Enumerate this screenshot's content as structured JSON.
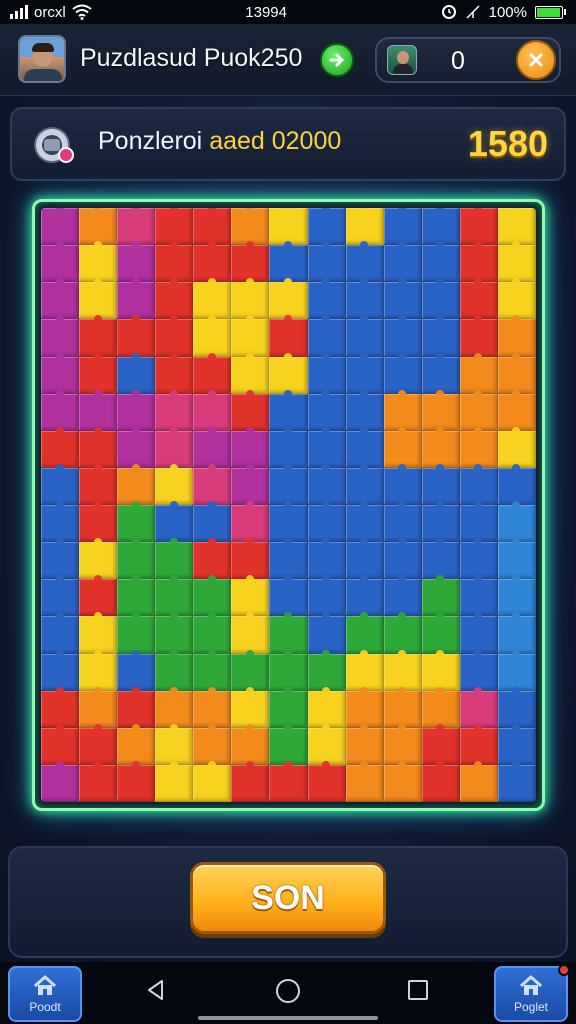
{
  "status_bar": {
    "carrier": "orcxl",
    "time": "13994",
    "battery": "100%",
    "battery_level": 0.95
  },
  "top_bar": {
    "title": "Puzdlasud Puok250",
    "opponent_score": "0"
  },
  "score_panel": {
    "label": "Ponzleroi",
    "value": "aaed 02000",
    "score": "1580"
  },
  "board": {
    "cols": 13,
    "rows": 16,
    "palette": {
      "M": "#b1319f",
      "P": "#d83c7a",
      "R": "#e2322c",
      "O": "#f28a1c",
      "Y": "#f7d21f",
      "B": "#2a63c6",
      "L": "#2f86d6",
      "G": "#2fa83a"
    },
    "tiles": [
      "MOPRROYBYBBRY",
      "MYMRRRBBBBBRY",
      "MYMRYYYBBBBRY",
      "MRRRYYRBBBBRO",
      "MRBRRYYBBBBOO",
      "MMMPPRBBBOOOO",
      "RRMPMMBBBOOOY",
      "BROYPMBBBBBBB",
      "BRGBBPBBBBBBL",
      "BYGGRRBBBBBBL",
      "BRGGGYBBBBGBL",
      "BYGGGYGBGGGBL",
      "BYBGGGGGYYYBL",
      "ROROOYGYOOOPB",
      "RROYOOGYOORRB",
      "MRRYYRRROOROB"
    ]
  },
  "action": {
    "label": "SON"
  },
  "nav": {
    "left_label": "Poodt",
    "right_label": "Poglet"
  }
}
